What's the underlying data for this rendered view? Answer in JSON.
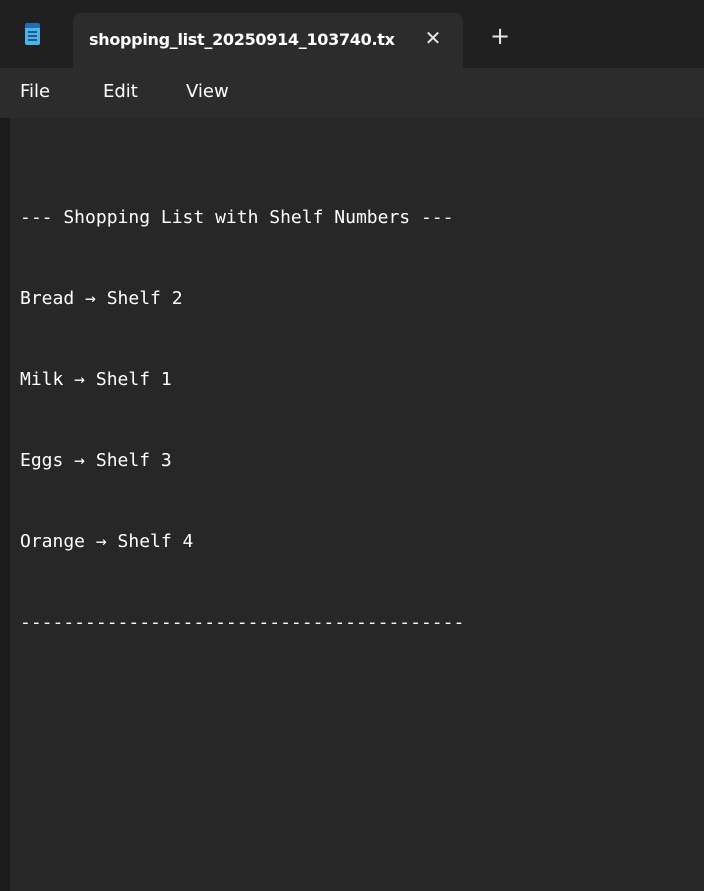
{
  "app": {
    "icon": "notepad-icon",
    "accent_color": "#4fb3e8"
  },
  "tabs": [
    {
      "title": "shopping_list_20250914_103740.tx",
      "close_icon": "close-icon",
      "close_glyph": "✕"
    }
  ],
  "new_tab": {
    "icon": "plus-icon",
    "glyph": "+"
  },
  "menu": {
    "file": "File",
    "edit": "Edit",
    "view": "View"
  },
  "document": {
    "lines": [
      "--- Shopping List with Shelf Numbers ---",
      "Bread → Shelf 2",
      "Milk → Shelf 1",
      "Eggs → Shelf 3",
      "Orange → Shelf 4",
      "-----------------------------------------"
    ]
  }
}
